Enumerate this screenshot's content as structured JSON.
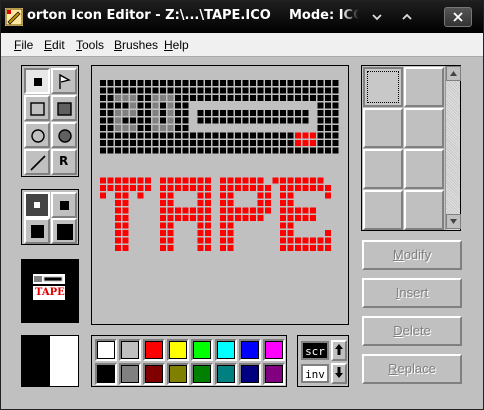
{
  "window": {
    "title": "orton Icon Editor - Z:\\...\\TAPE.ICO",
    "mode": "Mode: ICO"
  },
  "menu": [
    "File",
    "Edit",
    "Tools",
    "Brushes",
    "Help"
  ],
  "tools": {
    "text_tool_glyph": "R"
  },
  "preview": {
    "label": "TAPE"
  },
  "palette": {
    "colors": [
      "#ffffff",
      "#c0c0c0",
      "#ff0000",
      "#ffff00",
      "#00ff00",
      "#00ffff",
      "#0000ff",
      "#ff00ff",
      "#000000",
      "#808080",
      "#800000",
      "#808000",
      "#008000",
      "#008080",
      "#000080",
      "#800080"
    ]
  },
  "screen_panel": {
    "scr_label": "scr",
    "inv_label": "inv"
  },
  "actions": {
    "modify": "Modify",
    "insert": "Insert",
    "delete": "Delete",
    "replace": "Replace"
  },
  "canvas": {
    "colors": {
      "k": "#000000",
      "g": "#808080",
      "r": "#ff0000",
      "w": "#c0c0c0"
    },
    "rows": [
      "kkkkkkkkkkkkkkkkkkkkkkkkkkkkkkkk",
      "kkkkkkkkkkkkkkkkkkkkkkkkkkkkkkkk",
      "kkgggkkgggkkkkkkkkkkkkkkkkkkkkkk",
      "kkkkgkkgkgkkwwwwwwwwwwwwwwwwwkkk",
      "kkgggkkgkgkkwkkkkkkkkkkkkkkkwkkk",
      "kkgkkkkgkgkkwkkkkkkkkkkkkkkkwkkk",
      "kkgggkkgggkkwwwwwwwwwwwwwwwwwkkk",
      "kkkkkkkkkkkkkkkkkkkkkkkkkkrrrkkk",
      "kkkkkkkkkkkkkkkkkkkkkkkkkkrrrkkk",
      "kkkkkkkkkkkkkkkkkkkkkkkkkkkkkkkk",
      "................................",
      "................................",
      "................................",
      "rrrrrrr.rrrrrrr.rrrrrr.rrrrrrr..",
      "rrrrrrr.rrrrrrr.rrrrrrr.rrrrrrr.",
      "r.rr.r..rr...rr.rr...rr.rr....r.",
      "..rr....rr...rr.rr...rr.rr......",
      "..rr....rrrrrrr.rrrrrrr.rrrrr...",
      "..rr....rrrrrrr.rrrrrr..rrrrr...",
      "..rr....rr...rr.rr......rr......",
      "..rr....rr...rr.rr......rr....r.",
      "..rr....rr...rr.rr......rrrrrrr.",
      "..rr....rr...rr.rr......rrrrrrr.",
      "................................",
      "................................",
      "................................",
      "................................",
      "................................",
      "................................",
      "................................",
      "................................",
      "................................"
    ]
  }
}
